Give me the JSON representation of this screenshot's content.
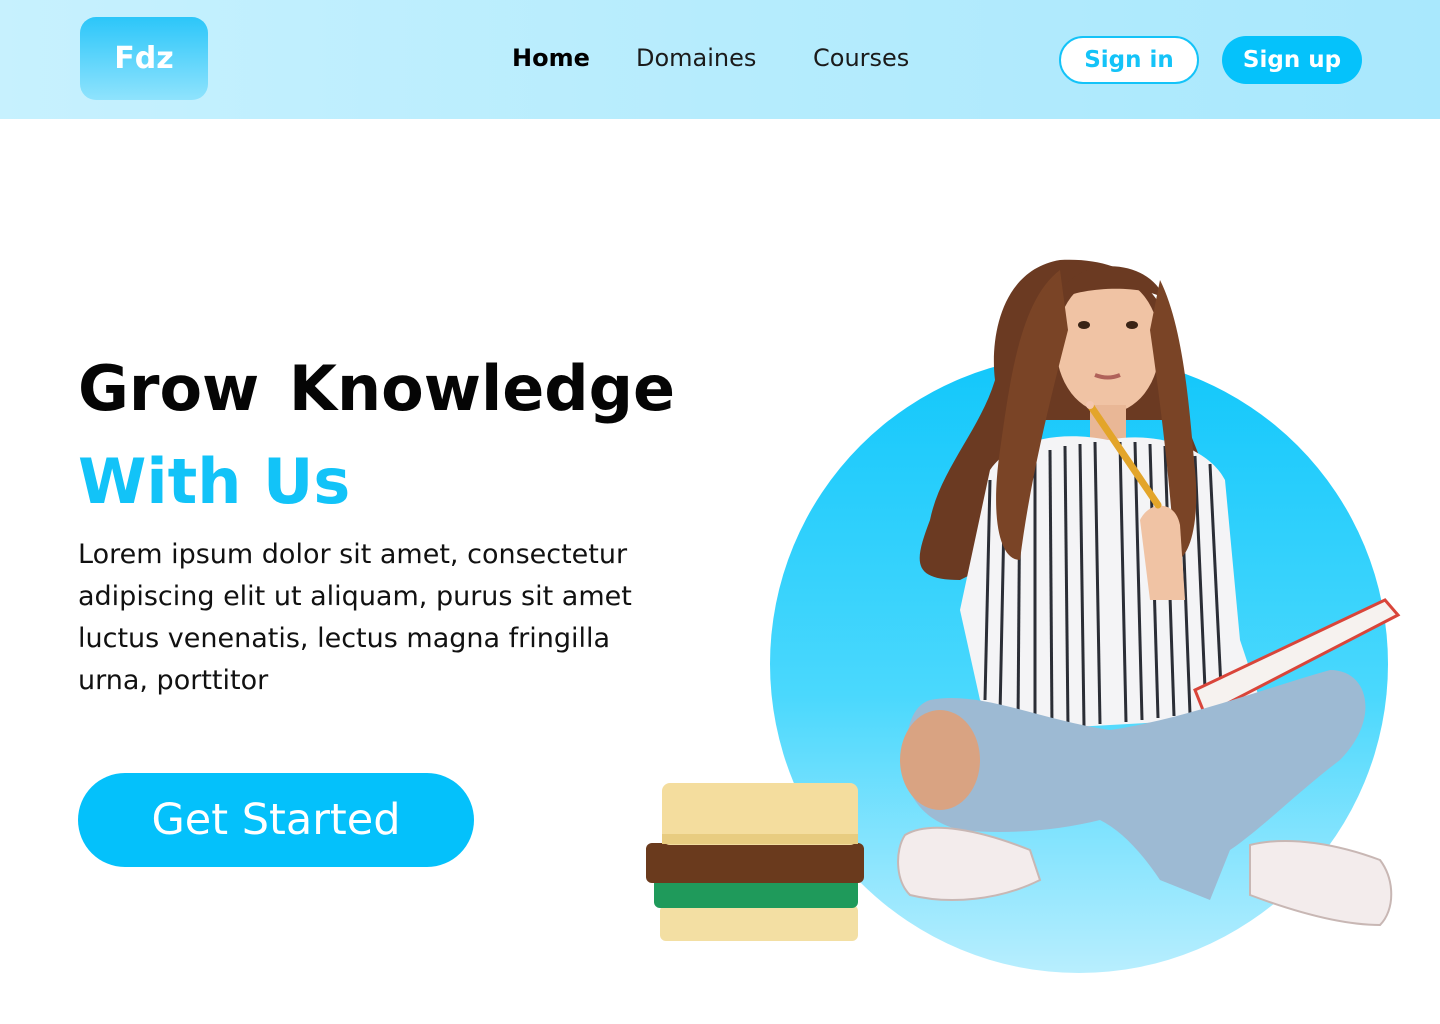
{
  "header": {
    "logo": "Fdz",
    "nav": {
      "home": "Home",
      "domaines": "Domaines",
      "courses": "Courses"
    },
    "signin_label": "Sign in",
    "signup_label": "Sign up"
  },
  "hero": {
    "title_line1": "Grow Knowledge",
    "title_line2": "With Us",
    "description": "Lorem ipsum dolor sit amet, consectetur adipiscing elit ut aliquam, purus sit amet luctus venenatis, lectus magna fringilla urna, porttitor",
    "cta_label": "Get Started"
  },
  "colors": {
    "accent": "#05c2fb",
    "header_bg": "#b6ecfd"
  },
  "icons": {
    "illustration": "student-with-books-illustration"
  }
}
